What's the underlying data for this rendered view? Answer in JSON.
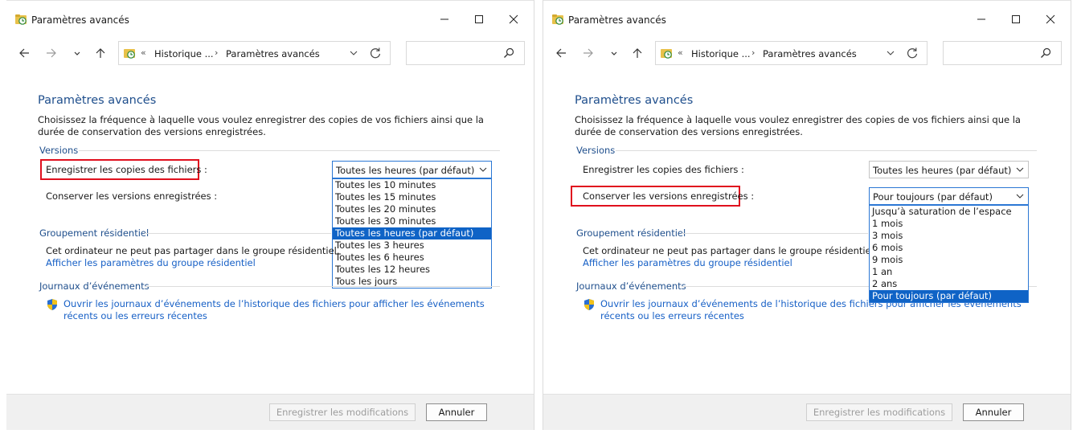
{
  "colors": {
    "accent": "#1e4e8c",
    "link": "#1760c6",
    "selected": "#0f63c6",
    "highlight": "#e0101e"
  },
  "windows": [
    {
      "title": "Paramètres avancés",
      "address": {
        "back_chevrons": "«",
        "crumb1": "Historique ...",
        "separator": "›",
        "crumb2": "Paramètres avancés"
      },
      "heading": "Paramètres avancés",
      "description": "Choisissez la fréquence à laquelle vous voulez enregistrer des copies de vos fichiers ainsi que la durée de conservation des versions enregistrées.",
      "versions_section": "Versions",
      "save_copies_label": "Enregistrer les copies des fichiers :",
      "save_copies_value": "Toutes les heures (par défaut)",
      "keep_versions_label": "Conserver les versions enregistrées :",
      "keep_versions_value": "",
      "dropdown_options": [
        "Toutes les 10 minutes",
        "Toutes les 15 minutes",
        "Toutes les 20 minutes",
        "Toutes les 30 minutes",
        "Toutes les heures (par défaut)",
        "Toutes les 3 heures",
        "Toutes les 6 heures",
        "Toutes les 12 heures",
        "Tous les jours"
      ],
      "dropdown_selected": "Toutes les heures (par défaut)",
      "homegroup_section": "Groupement résidentiel",
      "homegroup_text": "Cet ordinateur ne peut pas partager dans le groupe résidentiel.",
      "homegroup_link": "Afficher les paramètres du groupe résidentiel",
      "events_section": "Journaux d’événements",
      "events_link": "Ouvrir les journaux d’événements de l’historique des fichiers pour afficher les événements récents ou les erreurs récentes",
      "save_button": "Enregistrer les modifications",
      "cancel_button": "Annuler"
    },
    {
      "title": "Paramètres avancés",
      "address": {
        "back_chevrons": "«",
        "crumb1": "Historique ...",
        "separator": "›",
        "crumb2": "Paramètres avancés"
      },
      "heading": "Paramètres avancés",
      "description": "Choisissez la fréquence à laquelle vous voulez enregistrer des copies de vos fichiers ainsi que la durée de conservation des versions enregistrées.",
      "versions_section": "Versions",
      "save_copies_label": "Enregistrer les copies des fichiers :",
      "save_copies_value": "Toutes les heures (par défaut)",
      "keep_versions_label": "Conserver les versions enregistrées :",
      "keep_versions_value": "Pour toujours (par défaut)",
      "dropdown_options": [
        "Jusqu’à saturation de l’espace",
        "1 mois",
        "3 mois",
        "6 mois",
        "9 mois",
        "1 an",
        "2 ans",
        "Pour toujours (par défaut)"
      ],
      "dropdown_selected": "Pour toujours (par défaut)",
      "homegroup_section": "Groupement résidentiel",
      "homegroup_text": "Cet ordinateur ne peut pas partager dans le groupe résidentiel.",
      "homegroup_link": "Afficher les paramètres du groupe résidentiel",
      "events_section": "Journaux d’événements",
      "events_link": "Ouvrir les journaux d’événements de l’historique des fichiers pour afficher les événements récents ou les erreurs récentes",
      "save_button": "Enregistrer les modifications",
      "cancel_button": "Annuler"
    }
  ]
}
